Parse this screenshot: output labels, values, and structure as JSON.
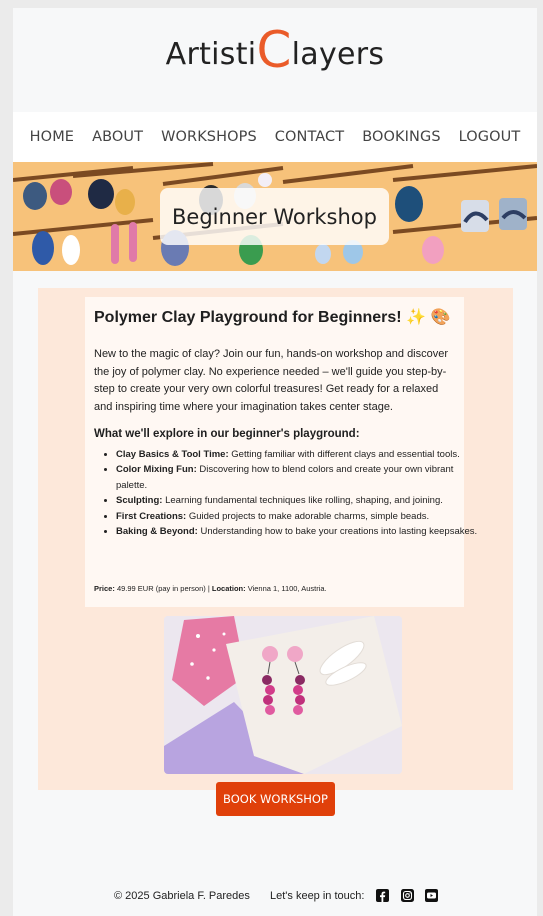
{
  "logo": {
    "prefix": "Artisti",
    "big_letter": "C",
    "suffix": "layers"
  },
  "nav": {
    "items": [
      "HOME",
      "ABOUT",
      "WORKSHOPS",
      "CONTACT",
      "BOOKINGS",
      "LOGOUT"
    ]
  },
  "banner": {
    "title": "Beginner Workshop"
  },
  "workshop": {
    "title": "Polymer Clay Playground for Beginners! ✨ 🎨",
    "intro": "New to the magic of clay? Join our fun, hands-on workshop and discover the joy of polymer clay. No experience needed – we'll guide you step-by-step to create your very own colorful treasures! Get ready for a relaxed and inspiring time where your imagination takes center stage.",
    "explore_heading": "What we'll explore in our beginner's playground:",
    "topics": [
      {
        "title": "Clay Basics & Tool Time:",
        "text": " Getting familiar with different clays and essential tools."
      },
      {
        "title": "Color Mixing Fun:",
        "text": " Discovering how to blend colors and create your own vibrant palette."
      },
      {
        "title": "Sculpting:",
        "text": " Learning fundamental techniques like rolling, shaping, and joining."
      },
      {
        "title": "First Creations:",
        "text": " Guided projects to make adorable charms, simple beads."
      },
      {
        "title": "Baking & Beyond:",
        "text": " Understanding how to bake your creations into lasting keepsakes."
      }
    ],
    "price_label": "Price:",
    "price_value": " 49.99 EUR (pay in person) | ",
    "location_label": "Location:",
    "location_value": " Vienna 1, 1100, Austria."
  },
  "book_button": "BOOK WORKSHOP",
  "footer": {
    "copyright": "© 2025 Gabriela F. Paredes",
    "keep_in_touch": "Let's keep in touch:",
    "social_icons": [
      "facebook-icon",
      "instagram-icon",
      "youtube-icon"
    ]
  },
  "colors": {
    "accent": "#ea5b29",
    "button": "#e0400a",
    "content_bg": "#fde8da",
    "card_bg": "#fff8f3"
  }
}
